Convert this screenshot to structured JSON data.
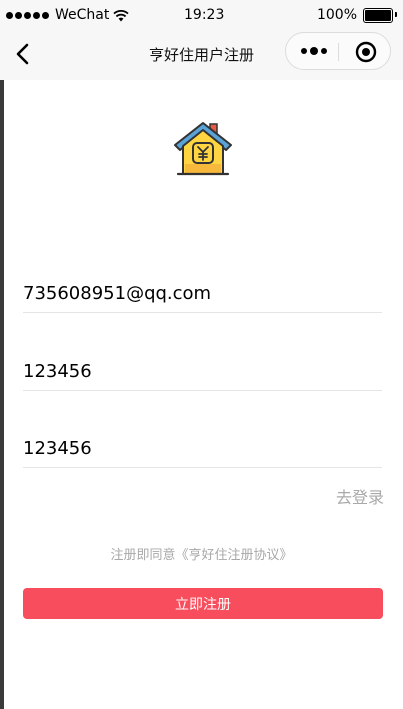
{
  "status_bar": {
    "carrier": "WeChat",
    "time": "19:23",
    "battery": "100%",
    "battery_level": 1.0
  },
  "nav": {
    "title": "亨好住用户注册"
  },
  "form": {
    "email_value": "735608951@qq.com",
    "password_value": "123456",
    "confirm_value": "123456"
  },
  "login_link": "去登录",
  "agreement": {
    "prefix": "注册即同意",
    "link": "《亨好住注册协议》"
  },
  "register_button": "立即注册",
  "colors": {
    "accent": "#f74d5c",
    "muted_text": "#a8a8a8",
    "nav_background": "#f7f7f7"
  },
  "icons": {
    "back": "chevron-left-icon",
    "more": "more-dots-icon",
    "close": "target-circle-icon",
    "logo": "house-yen-icon"
  }
}
